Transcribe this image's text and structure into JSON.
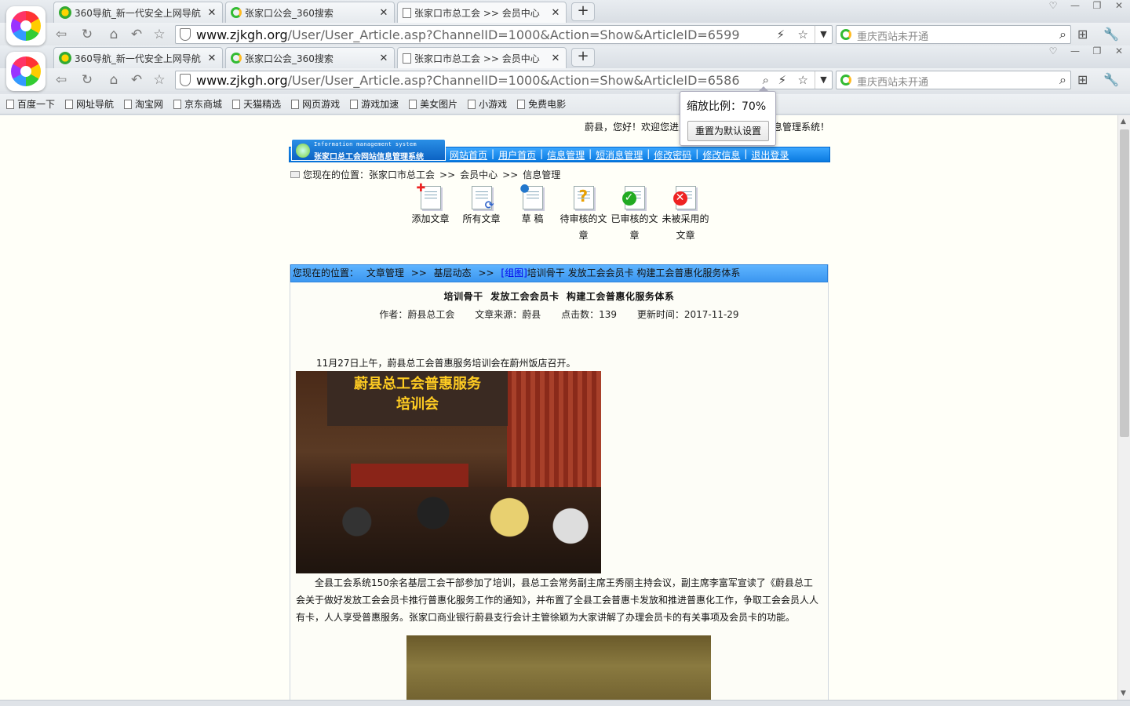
{
  "tabs": [
    {
      "title": "360导航_新一代安全上网导航",
      "icon": "360-nav-icon"
    },
    {
      "title": "张家口公会_360搜索",
      "icon": "360-search-icon"
    },
    {
      "title": "张家口市总工会 >> 会员中心",
      "icon": "page-icon"
    }
  ],
  "tabs2": [
    {
      "title": "360导航_新一代安全上网导航"
    },
    {
      "title": "张家口公会_360搜索"
    },
    {
      "title": "张家口市总工会 >> 会员中心"
    }
  ],
  "address1": {
    "domain": "www.zjkgh.org",
    "path": "/User/User_Article.asp?ChannelID=1000&Action=Show&ArticleID=6599"
  },
  "address2": {
    "domain": "www.zjkgh.org",
    "path": "/User/User_Article.asp?ChannelID=1000&Action=Show&ArticleID=6586"
  },
  "search": {
    "text": "重庆西站未开通"
  },
  "bookmarks": [
    "百度一下",
    "网址导航",
    "淘宝网",
    "京东商城",
    "天猫精选",
    "网页游戏",
    "游戏加速",
    "美女图片",
    "小游戏",
    "免费电影"
  ],
  "zoom": {
    "label": "缩放比例：70%",
    "reset_button": "重置为默认设置"
  },
  "site": {
    "greeting": "蔚县，您好！欢迎您进入张家口总工会网站信息管理系统！",
    "logo_en": "Information management system",
    "logo_cn": "张家口总工会网站信息管理系统",
    "menu": [
      "网站首页",
      "用户首页",
      "信息管理",
      "短消息管理",
      "修改密码",
      "修改信息",
      "退出登录"
    ],
    "location_label": "您现在的位置：",
    "location_path": [
      "张家口市总工会",
      "会员中心",
      "信息管理"
    ],
    "actions": [
      {
        "label": "添加文章",
        "icon": "add-article-icon"
      },
      {
        "label": "所有文章",
        "icon": "all-articles-icon"
      },
      {
        "label": "草 稿",
        "icon": "draft-icon"
      },
      {
        "label": "待审核的文章",
        "icon": "pending-icon"
      },
      {
        "label": "已审核的文章",
        "icon": "approved-icon"
      },
      {
        "label": "未被采用的文章",
        "icon": "rejected-icon"
      }
    ]
  },
  "article": {
    "crumb_label": "您现在的位置：",
    "crumb_path": [
      "文章管理",
      "基层动态"
    ],
    "crumb_tag": "[组图]",
    "crumb_title": "培训骨干 发放工会会员卡 构建工会普惠化服务体系",
    "title": "培训骨干  发放工会会员卡  构建工会普惠化服务体系",
    "author": "作者：蔚县总工会",
    "source": "文章来源：蔚县",
    "hits": "点击数：139",
    "updated": "更新时间：2017-11-29",
    "para1": "11月27日上午，蔚县总工会普惠服务培训会在蔚州饭店召开。",
    "photo1_banner": "蔚县总工会普惠服务\n培训会",
    "para2": "全县工会系统150余名基层工会干部参加了培训，县总工会常务副主席王秀丽主持会议，副主席李富军宣读了《蔚县总工会关于做好发放工会会员卡推行普惠化服务工作的通知》，并布置了全县工会普惠卡发放和推进普惠化工作，争取工会会员人人有卡，人人享受普惠服务。张家口商业银行蔚县支行会计主管徐颖为大家讲解了办理会员卡的有关事项及会员卡的功能。"
  }
}
